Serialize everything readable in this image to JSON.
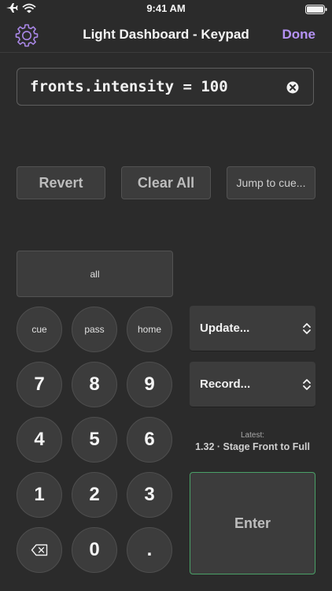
{
  "status_bar": {
    "time": "9:41 AM"
  },
  "nav": {
    "title": "Light Dashboard - Keypad",
    "done_label": "Done"
  },
  "command_field": {
    "value": "fronts.intensity = 100"
  },
  "actions": {
    "revert_label": "Revert",
    "clear_all_label": "Clear All",
    "jump_label": "Jump to cue..."
  },
  "keypad": {
    "all_label": "all",
    "cue_label": "cue",
    "pass_label": "pass",
    "home_label": "home",
    "digits": [
      "0",
      "1",
      "2",
      "3",
      "4",
      "5",
      "6",
      "7",
      "8",
      "9"
    ],
    "dot_label": "."
  },
  "side_panel": {
    "update_label": "Update...",
    "record_label": "Record...",
    "latest_caption": "Latest:",
    "latest_value": "1.32 · Stage Front to Full",
    "enter_label": "Enter"
  },
  "colors": {
    "accent": "#b592f4",
    "enter_border": "#4aa067",
    "background": "#2b2b2b",
    "button": "#3c3c3c"
  }
}
